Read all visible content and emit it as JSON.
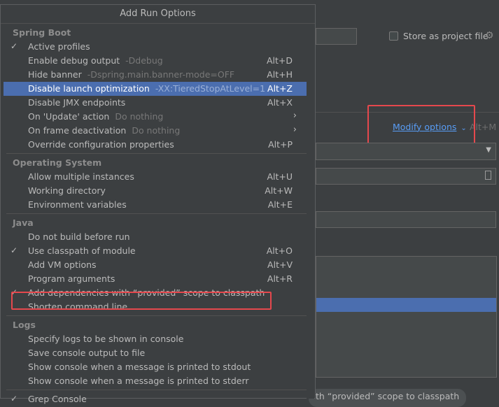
{
  "background": {
    "store_label": "Store as project file",
    "modify_options": "Modify options",
    "modify_options_shortcut": "Alt+M",
    "bottom_tag": "th “provided” scope to classpath"
  },
  "popup": {
    "title": "Add Run Options",
    "groups": [
      {
        "name": "Spring Boot",
        "items": [
          {
            "label": "Active profiles",
            "hint": "",
            "shortcut": "",
            "checked": true,
            "submenu": false,
            "selected": false
          },
          {
            "label": "Enable debug output",
            "hint": "-Ddebug",
            "shortcut": "Alt+D",
            "checked": false,
            "submenu": false,
            "selected": false
          },
          {
            "label": "Hide banner",
            "hint": "-Dspring.main.banner-mode=OFF",
            "shortcut": "Alt+H",
            "checked": false,
            "submenu": false,
            "selected": false
          },
          {
            "label": "Disable launch optimization",
            "hint": "-XX:TieredStopAtLevel=1",
            "shortcut": "Alt+Z",
            "checked": false,
            "submenu": false,
            "selected": true
          },
          {
            "label": "Disable JMX endpoints",
            "hint": "",
            "shortcut": "Alt+X",
            "checked": false,
            "submenu": false,
            "selected": false
          },
          {
            "label": "On 'Update' action",
            "hint": "Do nothing",
            "shortcut": "",
            "checked": false,
            "submenu": true,
            "selected": false
          },
          {
            "label": "On frame deactivation",
            "hint": "Do nothing",
            "shortcut": "",
            "checked": false,
            "submenu": true,
            "selected": false
          },
          {
            "label": "Override configuration properties",
            "hint": "",
            "shortcut": "Alt+P",
            "checked": false,
            "submenu": false,
            "selected": false
          }
        ]
      },
      {
        "name": "Operating System",
        "items": [
          {
            "label": "Allow multiple instances",
            "hint": "",
            "shortcut": "Alt+U",
            "checked": false,
            "submenu": false,
            "selected": false
          },
          {
            "label": "Working directory",
            "hint": "",
            "shortcut": "Alt+W",
            "checked": false,
            "submenu": false,
            "selected": false
          },
          {
            "label": "Environment variables",
            "hint": "",
            "shortcut": "Alt+E",
            "checked": false,
            "submenu": false,
            "selected": false
          }
        ]
      },
      {
        "name": "Java",
        "items": [
          {
            "label": "Do not build before run",
            "hint": "",
            "shortcut": "",
            "checked": false,
            "submenu": false,
            "selected": false
          },
          {
            "label": "Use classpath of module",
            "hint": "",
            "shortcut": "Alt+O",
            "checked": true,
            "submenu": false,
            "selected": false
          },
          {
            "label": "Add VM options",
            "hint": "",
            "shortcut": "Alt+V",
            "checked": false,
            "submenu": false,
            "selected": false
          },
          {
            "label": "Program arguments",
            "hint": "",
            "shortcut": "Alt+R",
            "checked": false,
            "submenu": false,
            "selected": false
          },
          {
            "label": "Add dependencies with “provided” scope to classpath",
            "hint": "",
            "shortcut": "",
            "checked": true,
            "submenu": false,
            "selected": false
          },
          {
            "label": "Shorten command line",
            "hint": "",
            "shortcut": "",
            "checked": false,
            "submenu": false,
            "selected": false
          }
        ]
      },
      {
        "name": "Logs",
        "items": [
          {
            "label": "Specify logs to be shown in console",
            "hint": "",
            "shortcut": "",
            "checked": false,
            "submenu": false,
            "selected": false
          },
          {
            "label": "Save console output to file",
            "hint": "",
            "shortcut": "",
            "checked": false,
            "submenu": false,
            "selected": false
          },
          {
            "label": "Show console when a message is printed to stdout",
            "hint": "",
            "shortcut": "",
            "checked": false,
            "submenu": false,
            "selected": false
          },
          {
            "label": "Show console when a message is printed to stderr",
            "hint": "",
            "shortcut": "",
            "checked": false,
            "submenu": false,
            "selected": false
          }
        ]
      },
      {
        "name": "",
        "items": [
          {
            "label": "Grep Console",
            "hint": "",
            "shortcut": "",
            "checked": true,
            "submenu": false,
            "selected": false
          }
        ]
      }
    ]
  },
  "colors": {
    "selection": "#4b6eaf",
    "highlight_box": "#e5484d",
    "link": "#589df6"
  }
}
